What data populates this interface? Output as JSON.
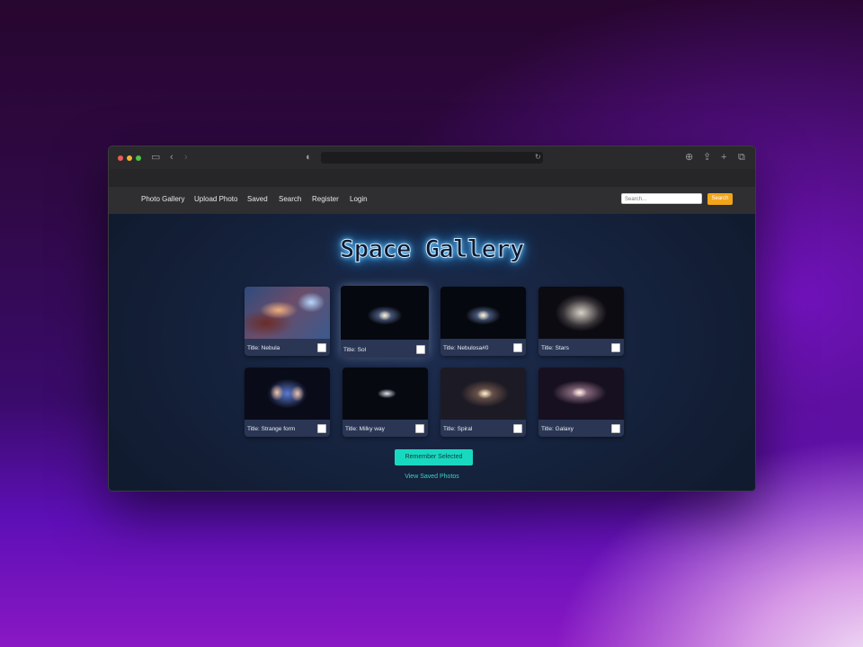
{
  "nav": {
    "items": [
      "Photo Gallery",
      "Upload Photo",
      "Saved",
      "Search",
      "Register",
      "Login"
    ]
  },
  "search": {
    "placeholder": "Search...",
    "button_label": "Search"
  },
  "page": {
    "heading": "Space Gallery"
  },
  "gallery": [
    {
      "caption": "Title: Nebula"
    },
    {
      "caption": "Title: Sol"
    },
    {
      "caption": "Title: Nebulosa#0"
    },
    {
      "caption": "Title: Stars"
    },
    {
      "caption": "Title: Strange form"
    },
    {
      "caption": "Title: Milky way"
    },
    {
      "caption": "Title: Spiral"
    },
    {
      "caption": "Title: Galaxy"
    }
  ],
  "actions": {
    "remember_label": "Remember Selected",
    "view_saved_label": "View Saved Photos"
  },
  "colors": {
    "accent_button": "#18d9c0",
    "search_button": "#f2a51a",
    "heading_glow": "#7fd3ff"
  }
}
